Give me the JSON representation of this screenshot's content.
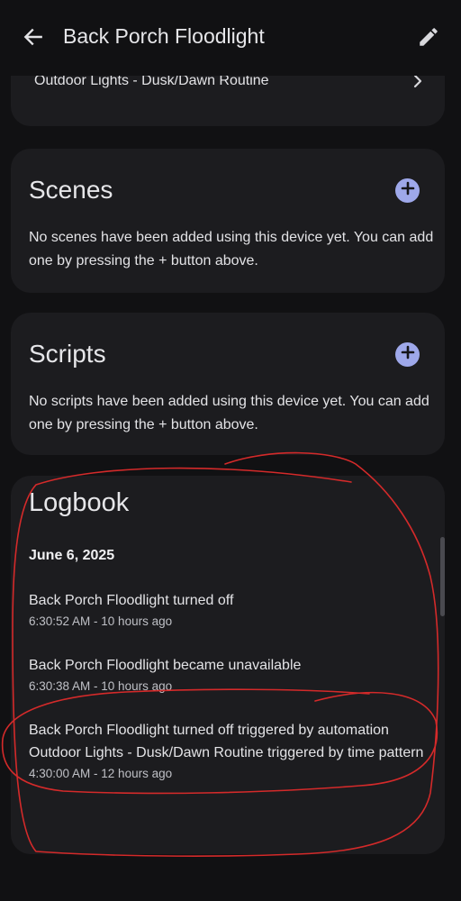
{
  "header": {
    "title": "Back Porch Floodlight"
  },
  "automations": {
    "item_label": "Outdoor Lights - Dusk/Dawn Routine"
  },
  "scenes": {
    "heading": "Scenes",
    "empty_text": "No scenes have been added using this device yet. You can add one by pressing the + button above."
  },
  "scripts": {
    "heading": "Scripts",
    "empty_text": "No scripts have been added using this device yet. You can add one by pressing the + button above."
  },
  "logbook": {
    "heading": "Logbook",
    "date": "June 6, 2025",
    "entries": [
      {
        "message": "Back Porch Floodlight turned off",
        "time": "6:30:52 AM - 10 hours ago"
      },
      {
        "message": "Back Porch Floodlight became unavailable",
        "time": "6:30:38 AM - 10 hours ago"
      },
      {
        "message": "Back Porch Floodlight turned off triggered by automation Outdoor Lights - Dusk/Dawn Routine triggered by time pattern",
        "time": "4:30:00 AM - 12 hours ago"
      }
    ]
  },
  "colors": {
    "background": "#111113",
    "card": "#1c1c1f",
    "accent": "#9ea8ea",
    "annotation": "#d42a2a"
  },
  "icons": [
    "arrow-left-icon",
    "pencil-icon",
    "chevron-right-icon",
    "plus-icon"
  ]
}
